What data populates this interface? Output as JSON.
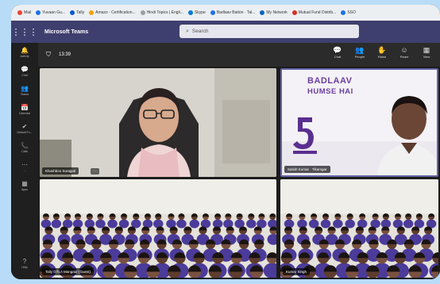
{
  "browser": {
    "bookmarks": [
      {
        "label": "Mail",
        "color": "#ea4335"
      },
      {
        "label": "Yuvaan Gu...",
        "color": "#1a73e8"
      },
      {
        "label": "Tally",
        "color": "#0b57d0"
      },
      {
        "label": "Amazo · Certification...",
        "color": "#f59f00"
      },
      {
        "label": "Hindi Topics | Engli...",
        "color": "#9e9e9e"
      },
      {
        "label": "Skype",
        "color": "#0078d4"
      },
      {
        "label": "Badlaav Baiton · Tal...",
        "color": "#1a73e8"
      },
      {
        "label": "My Network",
        "color": "#0a66c2"
      },
      {
        "label": "Mutual Fund Distrib...",
        "color": "#d93025"
      },
      {
        "label": "SSO",
        "color": "#1a73e8"
      }
    ]
  },
  "teams": {
    "app_title": "Microsoft Teams",
    "search_placeholder": "Search",
    "rail": [
      {
        "label": "Activity",
        "icon": "bell-icon",
        "glyph": "🔔"
      },
      {
        "label": "Chat",
        "icon": "chat-icon",
        "glyph": "💬"
      },
      {
        "label": "Teams",
        "icon": "teams-icon",
        "glyph": "👥"
      },
      {
        "label": "Calendar",
        "icon": "calendar-icon",
        "glyph": "📅"
      },
      {
        "label": "Default Fo...",
        "icon": "tasks-icon",
        "glyph": "✔"
      },
      {
        "label": "Calls",
        "icon": "phone-icon",
        "glyph": "📞"
      },
      {
        "label": "...",
        "icon": "more-icon",
        "glyph": "⋯"
      },
      {
        "label": "Apps",
        "icon": "apps-icon",
        "glyph": "▦"
      }
    ],
    "rail_help": {
      "label": "Help",
      "icon": "help-icon",
      "glyph": "?"
    },
    "meeting": {
      "timer": "13:39",
      "tools": [
        {
          "label": "Chat",
          "glyph": "💬",
          "icon": "chat-icon"
        },
        {
          "label": "People",
          "glyph": "👥",
          "icon": "people-icon"
        },
        {
          "label": "Raise",
          "glyph": "✋",
          "icon": "raise-hand-icon"
        },
        {
          "label": "React",
          "glyph": "☺",
          "icon": "react-icon"
        },
        {
          "label": "View",
          "glyph": "▦",
          "icon": "view-icon"
        }
      ]
    },
    "participants": [
      {
        "name": "Khushboo Surajpal"
      },
      {
        "name": "Satish Kumar · Tikamgar"
      },
      {
        "name": "Tally GTLA Mangaur (Guest)"
      },
      {
        "name": "Kumar Singh"
      }
    ],
    "banner": {
      "line1": "BADLAAV",
      "line2": "HUMSE HAI",
      "digit": "5"
    }
  }
}
